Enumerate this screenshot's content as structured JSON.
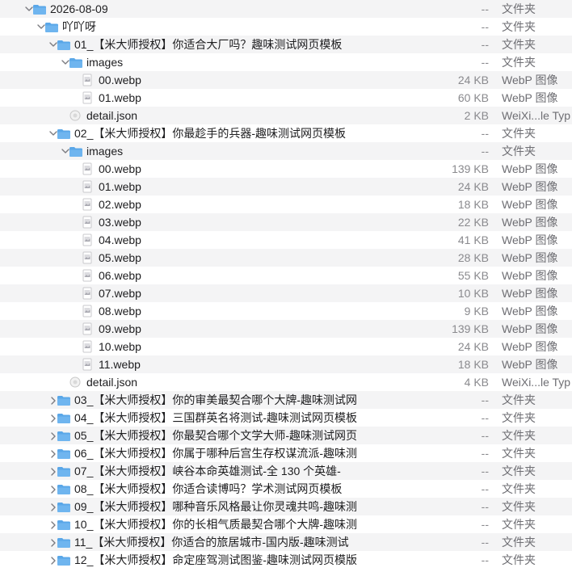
{
  "rows": [
    {
      "name": "2026-08-09",
      "size": "--",
      "kind": "文件夹",
      "type": "folder",
      "depth": 0,
      "disclosure": "open"
    },
    {
      "name": "吖吖呀",
      "size": "--",
      "kind": "文件夹",
      "type": "folder",
      "depth": 1,
      "disclosure": "open"
    },
    {
      "name": "01_【米大师授权】你适合大厂吗？趣味测试网页模板",
      "size": "--",
      "kind": "文件夹",
      "type": "folder",
      "depth": 2,
      "disclosure": "open"
    },
    {
      "name": "images",
      "size": "--",
      "kind": "文件夹",
      "type": "folder",
      "depth": 3,
      "disclosure": "open"
    },
    {
      "name": "00.webp",
      "size": "24 KB",
      "kind": "WebP 图像",
      "type": "image",
      "depth": 4
    },
    {
      "name": "01.webp",
      "size": "60 KB",
      "kind": "WebP 图像",
      "type": "image",
      "depth": 4
    },
    {
      "name": "detail.json",
      "size": "2 KB",
      "kind": "WeiXi...le Typ",
      "type": "json",
      "depth": 3
    },
    {
      "name": "02_【米大师授权】你最趁手的兵器-趣味测试网页模板",
      "size": "--",
      "kind": "文件夹",
      "type": "folder",
      "depth": 2,
      "disclosure": "open"
    },
    {
      "name": "images",
      "size": "--",
      "kind": "文件夹",
      "type": "folder",
      "depth": 3,
      "disclosure": "open"
    },
    {
      "name": "00.webp",
      "size": "139 KB",
      "kind": "WebP 图像",
      "type": "image",
      "depth": 4
    },
    {
      "name": "01.webp",
      "size": "24 KB",
      "kind": "WebP 图像",
      "type": "image",
      "depth": 4
    },
    {
      "name": "02.webp",
      "size": "18 KB",
      "kind": "WebP 图像",
      "type": "image",
      "depth": 4
    },
    {
      "name": "03.webp",
      "size": "22 KB",
      "kind": "WebP 图像",
      "type": "image",
      "depth": 4
    },
    {
      "name": "04.webp",
      "size": "41 KB",
      "kind": "WebP 图像",
      "type": "image",
      "depth": 4
    },
    {
      "name": "05.webp",
      "size": "28 KB",
      "kind": "WebP 图像",
      "type": "image",
      "depth": 4
    },
    {
      "name": "06.webp",
      "size": "55 KB",
      "kind": "WebP 图像",
      "type": "image",
      "depth": 4
    },
    {
      "name": "07.webp",
      "size": "10 KB",
      "kind": "WebP 图像",
      "type": "image",
      "depth": 4
    },
    {
      "name": "08.webp",
      "size": "9 KB",
      "kind": "WebP 图像",
      "type": "image",
      "depth": 4
    },
    {
      "name": "09.webp",
      "size": "139 KB",
      "kind": "WebP 图像",
      "type": "image",
      "depth": 4
    },
    {
      "name": "10.webp",
      "size": "24 KB",
      "kind": "WebP 图像",
      "type": "image",
      "depth": 4
    },
    {
      "name": "11.webp",
      "size": "18 KB",
      "kind": "WebP 图像",
      "type": "image",
      "depth": 4
    },
    {
      "name": "detail.json",
      "size": "4 KB",
      "kind": "WeiXi...le Typ",
      "type": "json",
      "depth": 3
    },
    {
      "name": "03_【米大师授权】你的审美最契合哪个大牌-趣味测试网",
      "size": "--",
      "kind": "文件夹",
      "type": "folder",
      "depth": 2,
      "disclosure": "closed"
    },
    {
      "name": "04_【米大师授权】三国群英名将测试-趣味测试网页模板",
      "size": "--",
      "kind": "文件夹",
      "type": "folder",
      "depth": 2,
      "disclosure": "closed"
    },
    {
      "name": "05_【米大师授权】你最契合哪个文学大师-趣味测试网页",
      "size": "--",
      "kind": "文件夹",
      "type": "folder",
      "depth": 2,
      "disclosure": "closed"
    },
    {
      "name": "06_【米大师授权】你属于哪种后宫生存权谋流派-趣味测",
      "size": "--",
      "kind": "文件夹",
      "type": "folder",
      "depth": 2,
      "disclosure": "closed"
    },
    {
      "name": "07_【米大师授权】峡谷本命英雄测试-全 130 个英雄-",
      "size": "--",
      "kind": "文件夹",
      "type": "folder",
      "depth": 2,
      "disclosure": "closed"
    },
    {
      "name": "08_【米大师授权】你适合读博吗？学术测试网页模板",
      "size": "--",
      "kind": "文件夹",
      "type": "folder",
      "depth": 2,
      "disclosure": "closed"
    },
    {
      "name": "09_【米大师授权】哪种音乐风格最让你灵魂共鸣-趣味测",
      "size": "--",
      "kind": "文件夹",
      "type": "folder",
      "depth": 2,
      "disclosure": "closed"
    },
    {
      "name": "10_【米大师授权】你的长相气质最契合哪个大牌-趣味测",
      "size": "--",
      "kind": "文件夹",
      "type": "folder",
      "depth": 2,
      "disclosure": "closed"
    },
    {
      "name": "11_【米大师授权】你适合的旅居城市-国内版-趣味测试",
      "size": "--",
      "kind": "文件夹",
      "type": "folder",
      "depth": 2,
      "disclosure": "closed"
    },
    {
      "name": "12_【米大师授权】命定座驾测试图鉴-趣味测试网页模版",
      "size": "--",
      "kind": "文件夹",
      "type": "folder",
      "depth": 2,
      "disclosure": "closed"
    }
  ],
  "colors": {
    "folder": "#5aa7e8",
    "folder_dark": "#3d8fd8",
    "row_alt": "#f4f4f5"
  }
}
